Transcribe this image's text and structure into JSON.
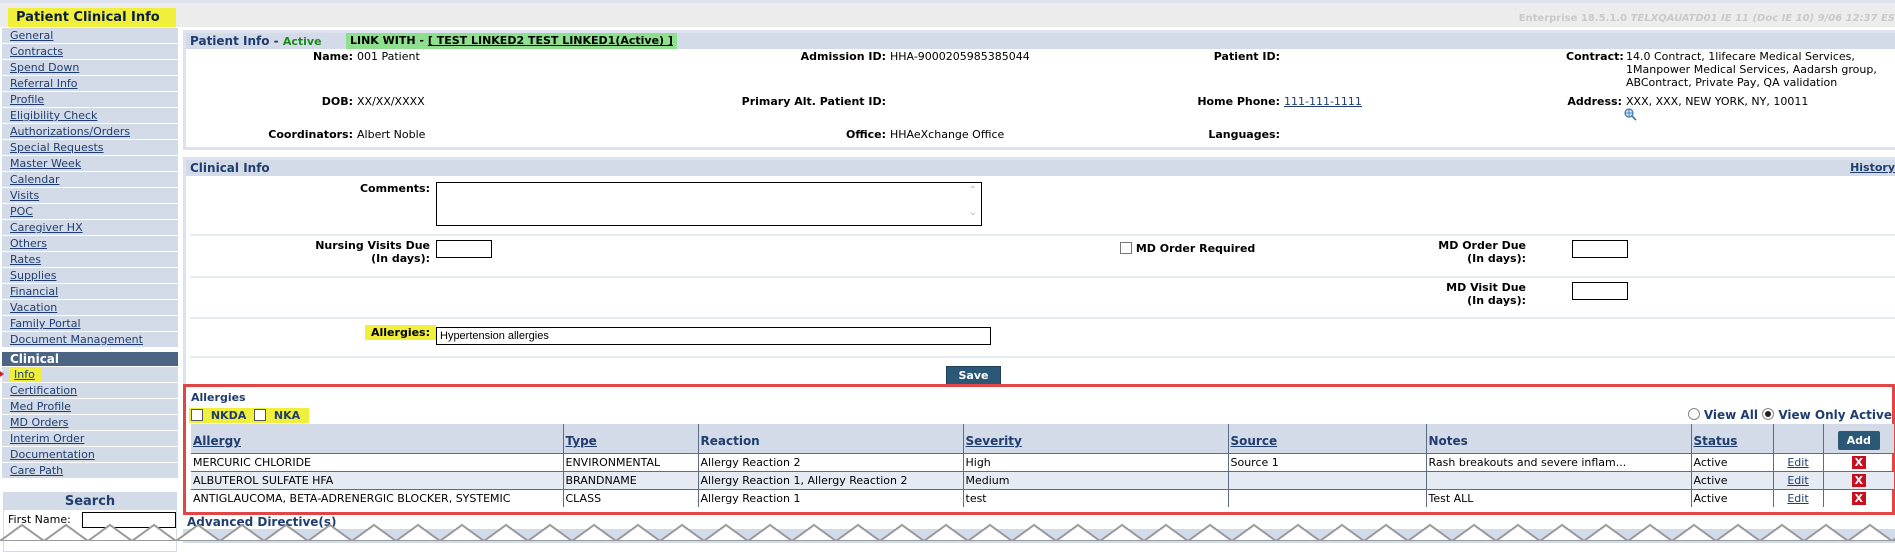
{
  "app": {
    "title": "Patient Clinical Info",
    "version_label": "Enterprise 18.5.1.0",
    "version_detail": "TELXQAUATD01 IE 11 (Doc IE 10) 9/06 12:37 ES"
  },
  "sidebar": {
    "items": [
      {
        "label": "General"
      },
      {
        "label": "Contracts"
      },
      {
        "label": "Spend Down"
      },
      {
        "label": "Referral Info"
      },
      {
        "label": "Profile"
      },
      {
        "label": "Eligibility Check"
      },
      {
        "label": "Authorizations/Orders"
      },
      {
        "label": "Special Requests"
      },
      {
        "label": "Master Week"
      },
      {
        "label": "Calendar"
      },
      {
        "label": "Visits"
      },
      {
        "label": "POC"
      },
      {
        "label": "Caregiver HX"
      },
      {
        "label": "Others"
      },
      {
        "label": "Rates"
      },
      {
        "label": "Supplies"
      },
      {
        "label": "Financial"
      },
      {
        "label": "Vacation"
      },
      {
        "label": "Family Portal"
      },
      {
        "label": "Document Management"
      }
    ],
    "clinical_section": "Clinical",
    "clinical_items": [
      {
        "label": "Info",
        "active": true
      },
      {
        "label": "Certification"
      },
      {
        "label": "Med Profile"
      },
      {
        "label": "MD Orders"
      },
      {
        "label": "Interim Order"
      },
      {
        "label": "Documentation"
      },
      {
        "label": "Care Path"
      }
    ],
    "search": {
      "title": "Search",
      "first_name_label": "First Name:",
      "first_name_value": ""
    }
  },
  "patient_info": {
    "header": "Patient Info -",
    "status": "Active",
    "link_with_prefix": "LINK WITH -",
    "link_with_value": "[ TEST  LINKED2 TEST  LINKED1(Active) ]",
    "fields": {
      "name_label": "Name:",
      "name_value": "001 Patient",
      "admission_label": "Admission ID:",
      "admission_value": "HHA-9000205985385044",
      "patient_id_label": "Patient ID:",
      "patient_id_value": "",
      "contract_label": "Contract:",
      "contract_value_1": "14.0 Contract, 1lifecare Medical Services,",
      "contract_value_2": "1Manpower Medical Services, Aadarsh group,",
      "contract_value_3": "ABContract, Private Pay, QA validation",
      "dob_label": "DOB:",
      "dob_value": "XX/XX/XXXX",
      "alt_id_label": "Primary Alt. Patient ID:",
      "alt_id_value": "",
      "home_phone_label": "Home Phone:",
      "home_phone_value": "111-111-1111",
      "address_label": "Address:",
      "address_value": "XXX, XXX, NEW YORK, NY, 10011",
      "coordinators_label": "Coordinators:",
      "coordinators_value": "Albert Noble",
      "office_label": "Office:",
      "office_value": "HHAeXchange Office",
      "languages_label": "Languages:",
      "languages_value": ""
    }
  },
  "clinical_info": {
    "header": "Clinical Info",
    "history_link": "History",
    "comments_label": "Comments:",
    "comments_value": "",
    "nursing_label_1": "Nursing Visits Due",
    "nursing_label_2": "(In days):",
    "nursing_value": "",
    "md_order_required_label": "MD Order Required",
    "md_order_required_checked": false,
    "md_order_due_label_1": "MD Order Due",
    "md_order_due_label_2": "(In days):",
    "md_order_due_value": "",
    "md_visit_due_label_1": "MD Visit Due",
    "md_visit_due_label_2": "(In days):",
    "md_visit_due_value": "",
    "allergies_label": "Allergies:",
    "allergies_value": "Hypertension allergies",
    "save_label": "Save"
  },
  "allergies": {
    "title": "Allergies",
    "nkda_label": "NKDA",
    "nka_label": "NKA",
    "view_all_label": "View All",
    "view_active_label": "View Only Active",
    "selected_view": "View Only Active",
    "add_label": "Add",
    "columns": [
      "Allergy",
      "Type",
      "Reaction",
      "Severity",
      "Source",
      "Notes",
      "Status"
    ],
    "rows": [
      {
        "allergy": "MERCURIC CHLORIDE",
        "type": "ENVIRONMENTAL",
        "reaction": "Allergy Reaction 2",
        "severity": "High",
        "source": "Source 1",
        "notes": "Rash breakouts and severe inflam...",
        "status": "Active",
        "edit": "Edit",
        "delete": "X"
      },
      {
        "allergy": "ALBUTEROL SULFATE HFA",
        "type": "BRANDNAME",
        "reaction": "Allergy Reaction 1, Allergy Reaction 2",
        "severity": "Medium",
        "source": "",
        "notes": "",
        "status": "Active",
        "edit": "Edit",
        "delete": "X"
      },
      {
        "allergy": "ANTIGLAUCOMA, BETA-ADRENERGIC BLOCKER, SYSTEMIC",
        "type": "CLASS",
        "reaction": "Allergy Reaction 1",
        "severity": "test",
        "source": "",
        "notes": "Test ALL",
        "status": "Active",
        "edit": "Edit",
        "delete": "X"
      }
    ]
  },
  "advanced_directives": {
    "title": "Advanced Directive(s)"
  }
}
